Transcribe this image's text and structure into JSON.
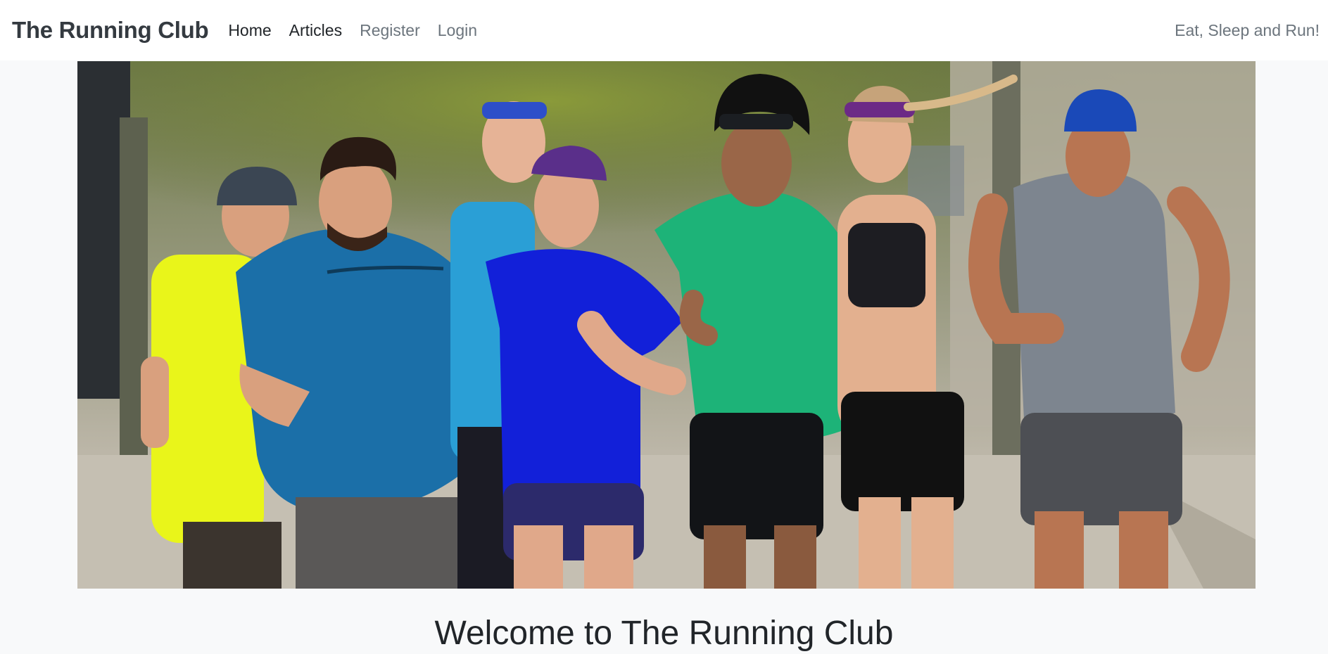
{
  "navbar": {
    "brand": "The Running Club",
    "links": [
      {
        "label": "Home",
        "state": "active"
      },
      {
        "label": "Articles",
        "state": "active"
      },
      {
        "label": "Register",
        "state": "muted"
      },
      {
        "label": "Login",
        "state": "muted"
      }
    ],
    "tagline": "Eat, Sleep and Run!"
  },
  "hero": {
    "image_subject": "group of seven runners running on a sidewalk"
  },
  "main": {
    "heading": "Welcome to The Running Club"
  },
  "colors": {
    "navbar_bg": "#ffffff",
    "page_bg": "#f8f9fa",
    "text_dark": "#212529",
    "text_muted": "#6c757d"
  }
}
